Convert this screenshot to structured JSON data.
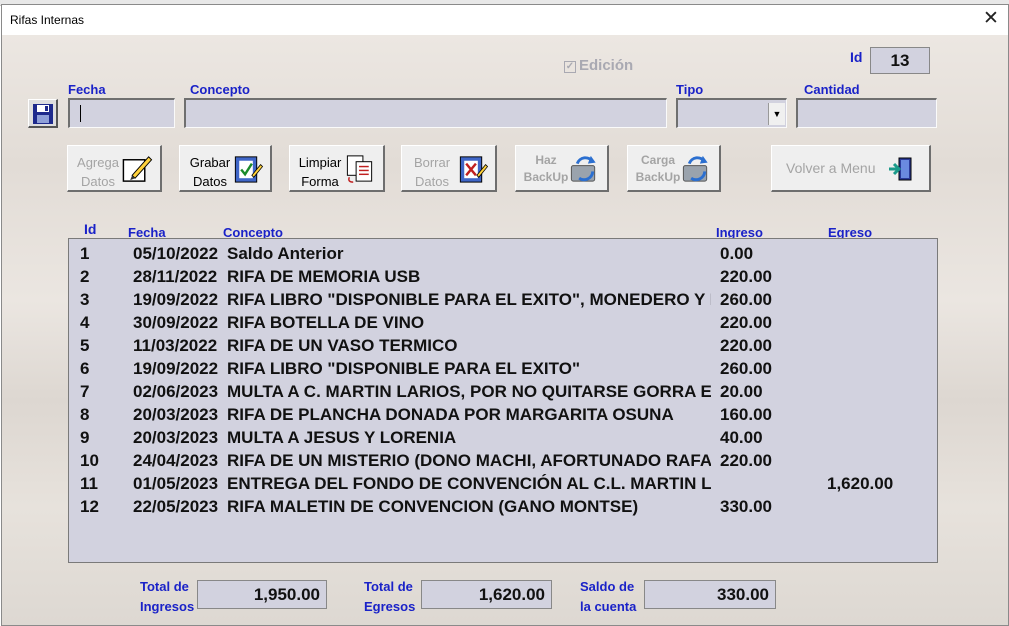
{
  "window": {
    "title": "Rifas Internas"
  },
  "header": {
    "edicion_label": "Edición",
    "id_label": "Id",
    "id_value": "13"
  },
  "form": {
    "fecha_label": "Fecha",
    "fecha_value": "",
    "concepto_label": "Concepto",
    "concepto_value": "",
    "tipo_label": "Tipo",
    "tipo_value": "",
    "cantidad_label": "Cantidad",
    "cantidad_value": ""
  },
  "toolbar": {
    "agrega": "Agrega\nDatos",
    "grabar": "Grabar\nDatos",
    "limpiar": "Limpiar\nForma",
    "borrar": "Borrar\nDatos",
    "haz": "Haz\nBackUp",
    "carga": "Carga\nBackUp",
    "volver": "Volver a Menu"
  },
  "table": {
    "headers": {
      "id": "Id",
      "fecha": "Fecha",
      "concepto": "Concepto",
      "ingreso": "Ingreso",
      "egreso": "Egreso"
    },
    "rows": [
      {
        "id": "1",
        "fecha": "05/10/2022",
        "concepto": "Saldo Anterior",
        "ingreso": "0.00",
        "egreso": ""
      },
      {
        "id": "2",
        "fecha": "28/11/2022",
        "concepto": "RIFA DE MEMORIA USB",
        "ingreso": "220.00",
        "egreso": ""
      },
      {
        "id": "3",
        "fecha": "19/09/2022",
        "concepto": "RIFA LIBRO \"DISPONIBLE PARA EL EXITO\", MONEDERO Y PLUMA",
        "ingreso": "260.00",
        "egreso": ""
      },
      {
        "id": "4",
        "fecha": "30/09/2022",
        "concepto": "RIFA BOTELLA DE VINO",
        "ingreso": "220.00",
        "egreso": ""
      },
      {
        "id": "5",
        "fecha": "11/03/2022",
        "concepto": "RIFA DE UN VASO TERMICO",
        "ingreso": "220.00",
        "egreso": ""
      },
      {
        "id": "6",
        "fecha": "19/09/2022",
        "concepto": "RIFA LIBRO \"DISPONIBLE PARA EL EXITO\"",
        "ingreso": "260.00",
        "egreso": ""
      },
      {
        "id": "7",
        "fecha": "02/06/2023",
        "concepto": "MULTA A C. MARTIN LARIOS, POR NO QUITARSE GORRA EN HONORES",
        "ingreso": "20.00",
        "egreso": ""
      },
      {
        "id": "8",
        "fecha": "20/03/2023",
        "concepto": "RIFA DE PLANCHA  DONADA POR MARGARITA OSUNA",
        "ingreso": "160.00",
        "egreso": ""
      },
      {
        "id": "9",
        "fecha": "20/03/2023",
        "concepto": "MULTA A JESUS Y LORENIA",
        "ingreso": "40.00",
        "egreso": ""
      },
      {
        "id": "10",
        "fecha": "24/04/2023",
        "concepto": "RIFA DE UN MISTERIO (DONO MACHI, AFORTUNADO RAFAEL)",
        "ingreso": "220.00",
        "egreso": ""
      },
      {
        "id": "11",
        "fecha": "01/05/2023",
        "concepto": "ENTREGA DEL FONDO DE CONVENCIÓN AL C.L. MARTIN LARIOS",
        "ingreso": "",
        "egreso": "1,620.00"
      },
      {
        "id": "12",
        "fecha": "22/05/2023",
        "concepto": "RIFA MALETIN DE CONVENCION  (GANO MONTSE)",
        "ingreso": "330.00",
        "egreso": ""
      }
    ]
  },
  "totals": {
    "ingresos_label": "Total de\nIngresos",
    "ingresos_value": "1,950.00",
    "egresos_label": "Total de\nEgresos",
    "egresos_value": "1,620.00",
    "saldo_label": "Saldo de\nla cuenta",
    "saldo_value": "330.00"
  },
  "colors": {
    "label_blue": "#1a22c8",
    "field_bg": "#d2d2df",
    "disabled_text": "#a4a4a4"
  }
}
